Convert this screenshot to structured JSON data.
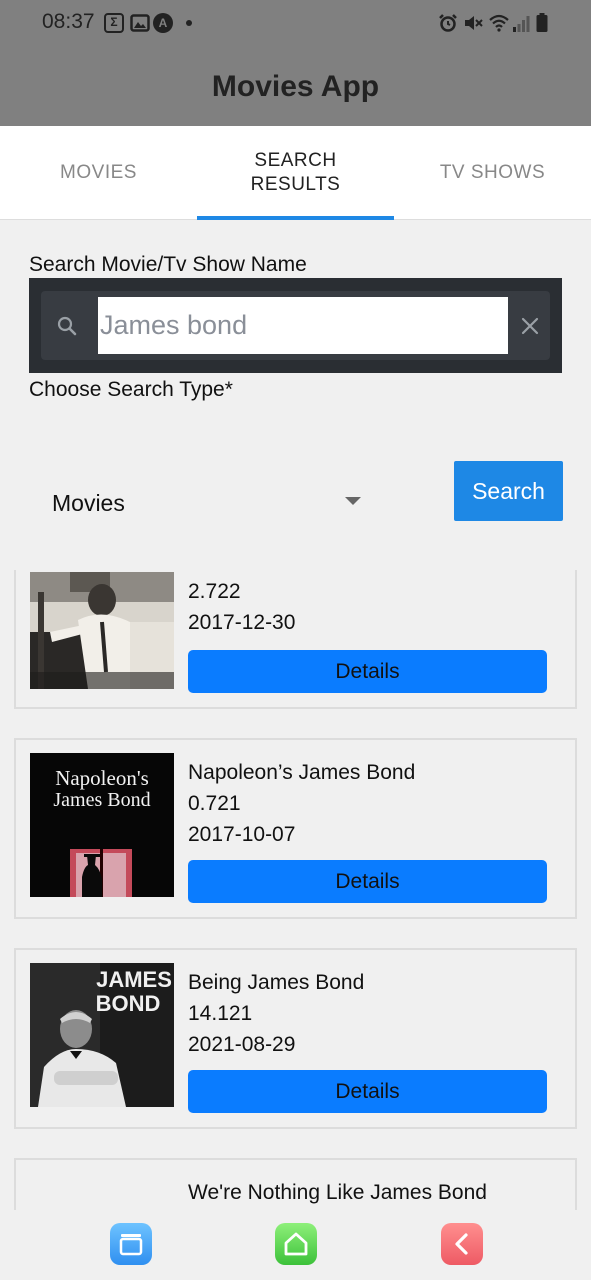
{
  "status_bar": {
    "time": "08:37",
    "sigma": "Σ",
    "a_icon": "A"
  },
  "app": {
    "title": "Movies App"
  },
  "tabs": [
    {
      "label": "MOVIES"
    },
    {
      "label": "SEARCH\nRESULTS"
    },
    {
      "label": "TV SHOWS"
    }
  ],
  "search": {
    "name_label": "Search Movie/Tv Show Name",
    "placeholder": "James bond",
    "type_label": "Choose Search Type*",
    "type_value": "Movies",
    "button_label": "Search"
  },
  "results": [
    {
      "title": "",
      "rating": "2.722",
      "date": "2017-12-30",
      "button": "Details"
    },
    {
      "title": "Napoleon’s James Bond",
      "rating": "0.721",
      "date": "2017-10-07",
      "button": "Details",
      "poster_text": [
        "Napoleon's",
        "James Bond"
      ]
    },
    {
      "title": "Being James Bond",
      "rating": "14.121",
      "date": "2021-08-29",
      "button": "Details",
      "poster_text": [
        "JAMES",
        "BOND"
      ]
    },
    {
      "title": "We're Nothing Like James Bond"
    }
  ],
  "colors": {
    "accent": "#1e88e5",
    "details_button": "#0a7cff",
    "header": "#808080"
  },
  "bottom_nav": [
    "recents-icon",
    "home-icon",
    "back-icon"
  ]
}
